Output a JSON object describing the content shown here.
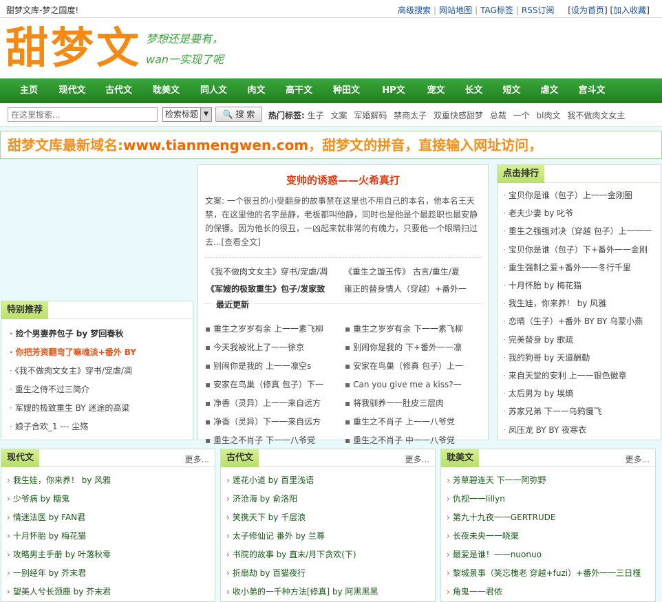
{
  "top": {
    "site_title": "甜梦文库-梦之国度!",
    "links": [
      "高级搜索",
      "网站地图",
      "TAG标签",
      "RSS订阅"
    ],
    "extra": [
      "设为首页",
      "加入收藏"
    ]
  },
  "header": {
    "logo": "甜梦文",
    "slogan_line1": "梦想还是要有，",
    "slogan_line2": "wan一实现了呢"
  },
  "nav": {
    "items": [
      "主页",
      "现代文",
      "古代文",
      "耽美文",
      "同人文",
      "肉文",
      "高干文",
      "种田文",
      "HP文",
      "宠文",
      "长文",
      "短文",
      "虐文",
      "宫斗文"
    ]
  },
  "search": {
    "placeholder": "在这里搜索...",
    "select_value": "检索标题",
    "button": "搜 索",
    "hot_label": "热门标签:",
    "hot_tags": [
      "生子",
      "文案",
      "军婚解码",
      "禁商太子",
      "双重快感甜梦",
      "总裁",
      "一个",
      "bl肉文",
      "我不做肉文女主"
    ]
  },
  "notice": {
    "prefix": "甜梦文库最新域名:",
    "domain": "www.tianmengwen.com",
    "suffix": "，甜梦文的拼音，直接输入网址访问，"
  },
  "recommend": {
    "title": "特别推荐",
    "items": [
      "捡个男妻养包子  by 梦回春秋",
      "你把芳资翻弯了嘛魂淡+番外  BY",
      "《我不做肉文女主》穿书/宠虐/凋",
      "重生之侍不过三简介",
      "军嫂的极致重生  BY 迷途的高粱",
      "娘子合欢_1 --- 尘殇"
    ]
  },
  "feature": {
    "title": "变帅的诱惑——火希真打",
    "summary": "文案: 一个很丑的小受翻身的故事禁在这里也不用自己的本名，他本名王天禁，在这里他的名字是静，老板都叫他静，同时也是他是个最趁职也最安静的保镖。因为他长的很丑，一凶起来就非常的有魄力，只要他一个眼睛扫过去...",
    "more": "[查看全文]",
    "links": [
      [
        "《我不做肉文女主》穿书/宠虐/凋",
        "《重生之璇玉传》 古言/重生/夏"
      ],
      [
        "《军嫂的极致重生》包子/发家致",
        "雍正的替身情人（穿越）+番外一"
      ]
    ],
    "updates_title": "最近更新",
    "updates": [
      "重生之岁岁有余 上一一素飞柳",
      "重生之岁岁有余 下一一素飞柳",
      "今天我被讹上了一一徐京",
      "别闹你是我的 下+番外一一凛",
      "别闹你是我的 上一一凛空s",
      "安家在鸟巢（修真 包子）上一",
      "安家在鸟巢（修真 包子）下一",
      "Can you give me a kiss?一",
      "净香（灵异）上一一来自远方",
      "将我驯养一一肚皮三层肉",
      "净香（灵异）下一一来自远方",
      "重生之不肖子 上一一八爷党",
      "重生之不肖子 下一一八爷党",
      "重生之不肖子 中一一八爷党"
    ]
  },
  "rank": {
    "title": "点击排行",
    "items": [
      "宝贝你是谁（包子）上一一金刚圈",
      "老夫少妻 by 叱爷",
      "重生之强强对决（穿越 包子）上一一一",
      "宝贝你是谁（包子）下+番外一一金刚",
      "重生强制之爱+番外一一冬行千里",
      "十月怀胎 by 梅花猫",
      "我生娃，你来养！ by 风雅",
      "恋晴（生子）+番外 BY BY 乌蒙小燕",
      "完美替身 by 歌疏",
      "我的狗哥 by 天道酬勤",
      "来自天堂的安利 上一一银色徽章",
      "太后男为 by 埃熵",
      "苏家兄弟 下一一乌鸦慢飞",
      "凤压龙 BY BY 夜寒衣"
    ]
  },
  "categories": [
    {
      "title": "现代文",
      "more": "更多...",
      "items": [
        "我生娃，你来养！ by 风雅",
        "少爷病 by 糖鬼",
        "情迷法医 by FAN君",
        "十月怀胎 by 梅花猫",
        "攻略男主手册 by 叶落秋零",
        "一别经年 by 芥末君",
        "望美人兮长颈鹿 by 芥末君"
      ]
    },
    {
      "title": "古代文",
      "more": "更多...",
      "items": [
        "莲花小道 by 百里浅语",
        "济沧海 by 俞洛阳",
        "笑携天下 by 千层浪",
        "太子修仙记 番外 by 兰尊",
        "书院的故事 by 直末/月下贪欢(下)",
        "折扇劫 by 百猫夜行",
        "收小弟的一千种方法[修真] by 阿黑黑黑"
      ]
    },
    {
      "title": "耽美文",
      "more": "更多...",
      "items": [
        "芳草碧连天 下一一阿弥野",
        "仇视一一lillyn",
        "第九十九夜一一GERTRUDE",
        "长夜未央一一晓渠",
        "最爱是谁！一一nuonuo",
        "黎城景事（笑忘槐老 穿越+fuzi）+番外一一三日槿",
        "角鬼一一君侬"
      ]
    }
  ]
}
